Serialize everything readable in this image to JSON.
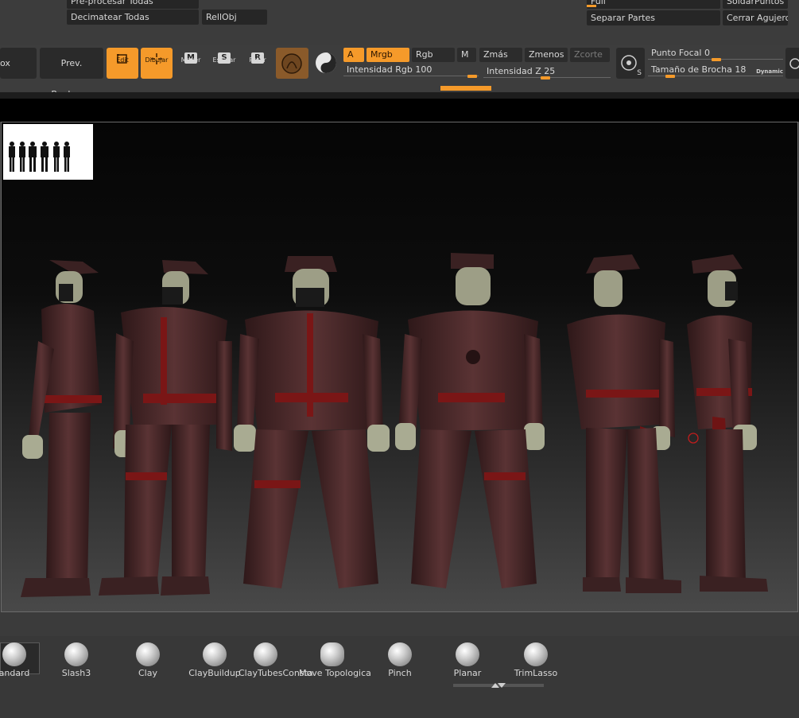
{
  "top_buttons": {
    "preprocess_all": "Pre-procesar Todas",
    "decimate_all": "Decimatear Todas",
    "rellobj": "RellObj",
    "full": "Full",
    "weld_points": "SoldarPuntos",
    "split_parts": "Separar Partes",
    "close_holes": "Cerrar Agujeros"
  },
  "toolbar": {
    "box_partial": "ox",
    "prev_boolean": "Prev. Booleana",
    "edit": "Edit",
    "draw": "Dibujar",
    "move": "Mover",
    "move_icon_letter": "M",
    "scale": "Escalar",
    "scale_icon_letter": "S",
    "rotate": "Rotar",
    "rotate_icon_letter": "R",
    "a": "A",
    "mrgb": "Mrgb",
    "rgb": "Rgb",
    "m": "M",
    "zadd": "Zmás",
    "zsub": "Zmenos",
    "zcut": "Zcorte",
    "rgb_intensity_label": "Intensidad Rgb",
    "rgb_intensity_value": "100",
    "z_intensity_label": "Intensidad Z",
    "z_intensity_value": "25",
    "focal_label": "Punto Focal",
    "focal_value": "0",
    "brush_size_label": "Tamaño de Brocha",
    "brush_size_value": "18",
    "dynamic": "Dynamic",
    "s_letter": "S"
  },
  "slider_levels": {
    "rgb_intensity": 100,
    "z_intensity": 25,
    "focal_shift": 0,
    "brush_size": 18
  },
  "brushes": [
    {
      "label": "andard"
    },
    {
      "label": "Slash3"
    },
    {
      "label": "Clay"
    },
    {
      "label": "ClayBuildup"
    },
    {
      "label": "ClayTubesConsta"
    },
    {
      "label": "Move Topologica"
    },
    {
      "label": "Pinch"
    },
    {
      "label": "Planar"
    },
    {
      "label": "TrimLasso"
    }
  ],
  "colors": {
    "accent": "#f59a2a",
    "figure_body": "#4a2a2b",
    "figure_detail": "#7a1616",
    "figure_skin": "#a9ab92"
  }
}
